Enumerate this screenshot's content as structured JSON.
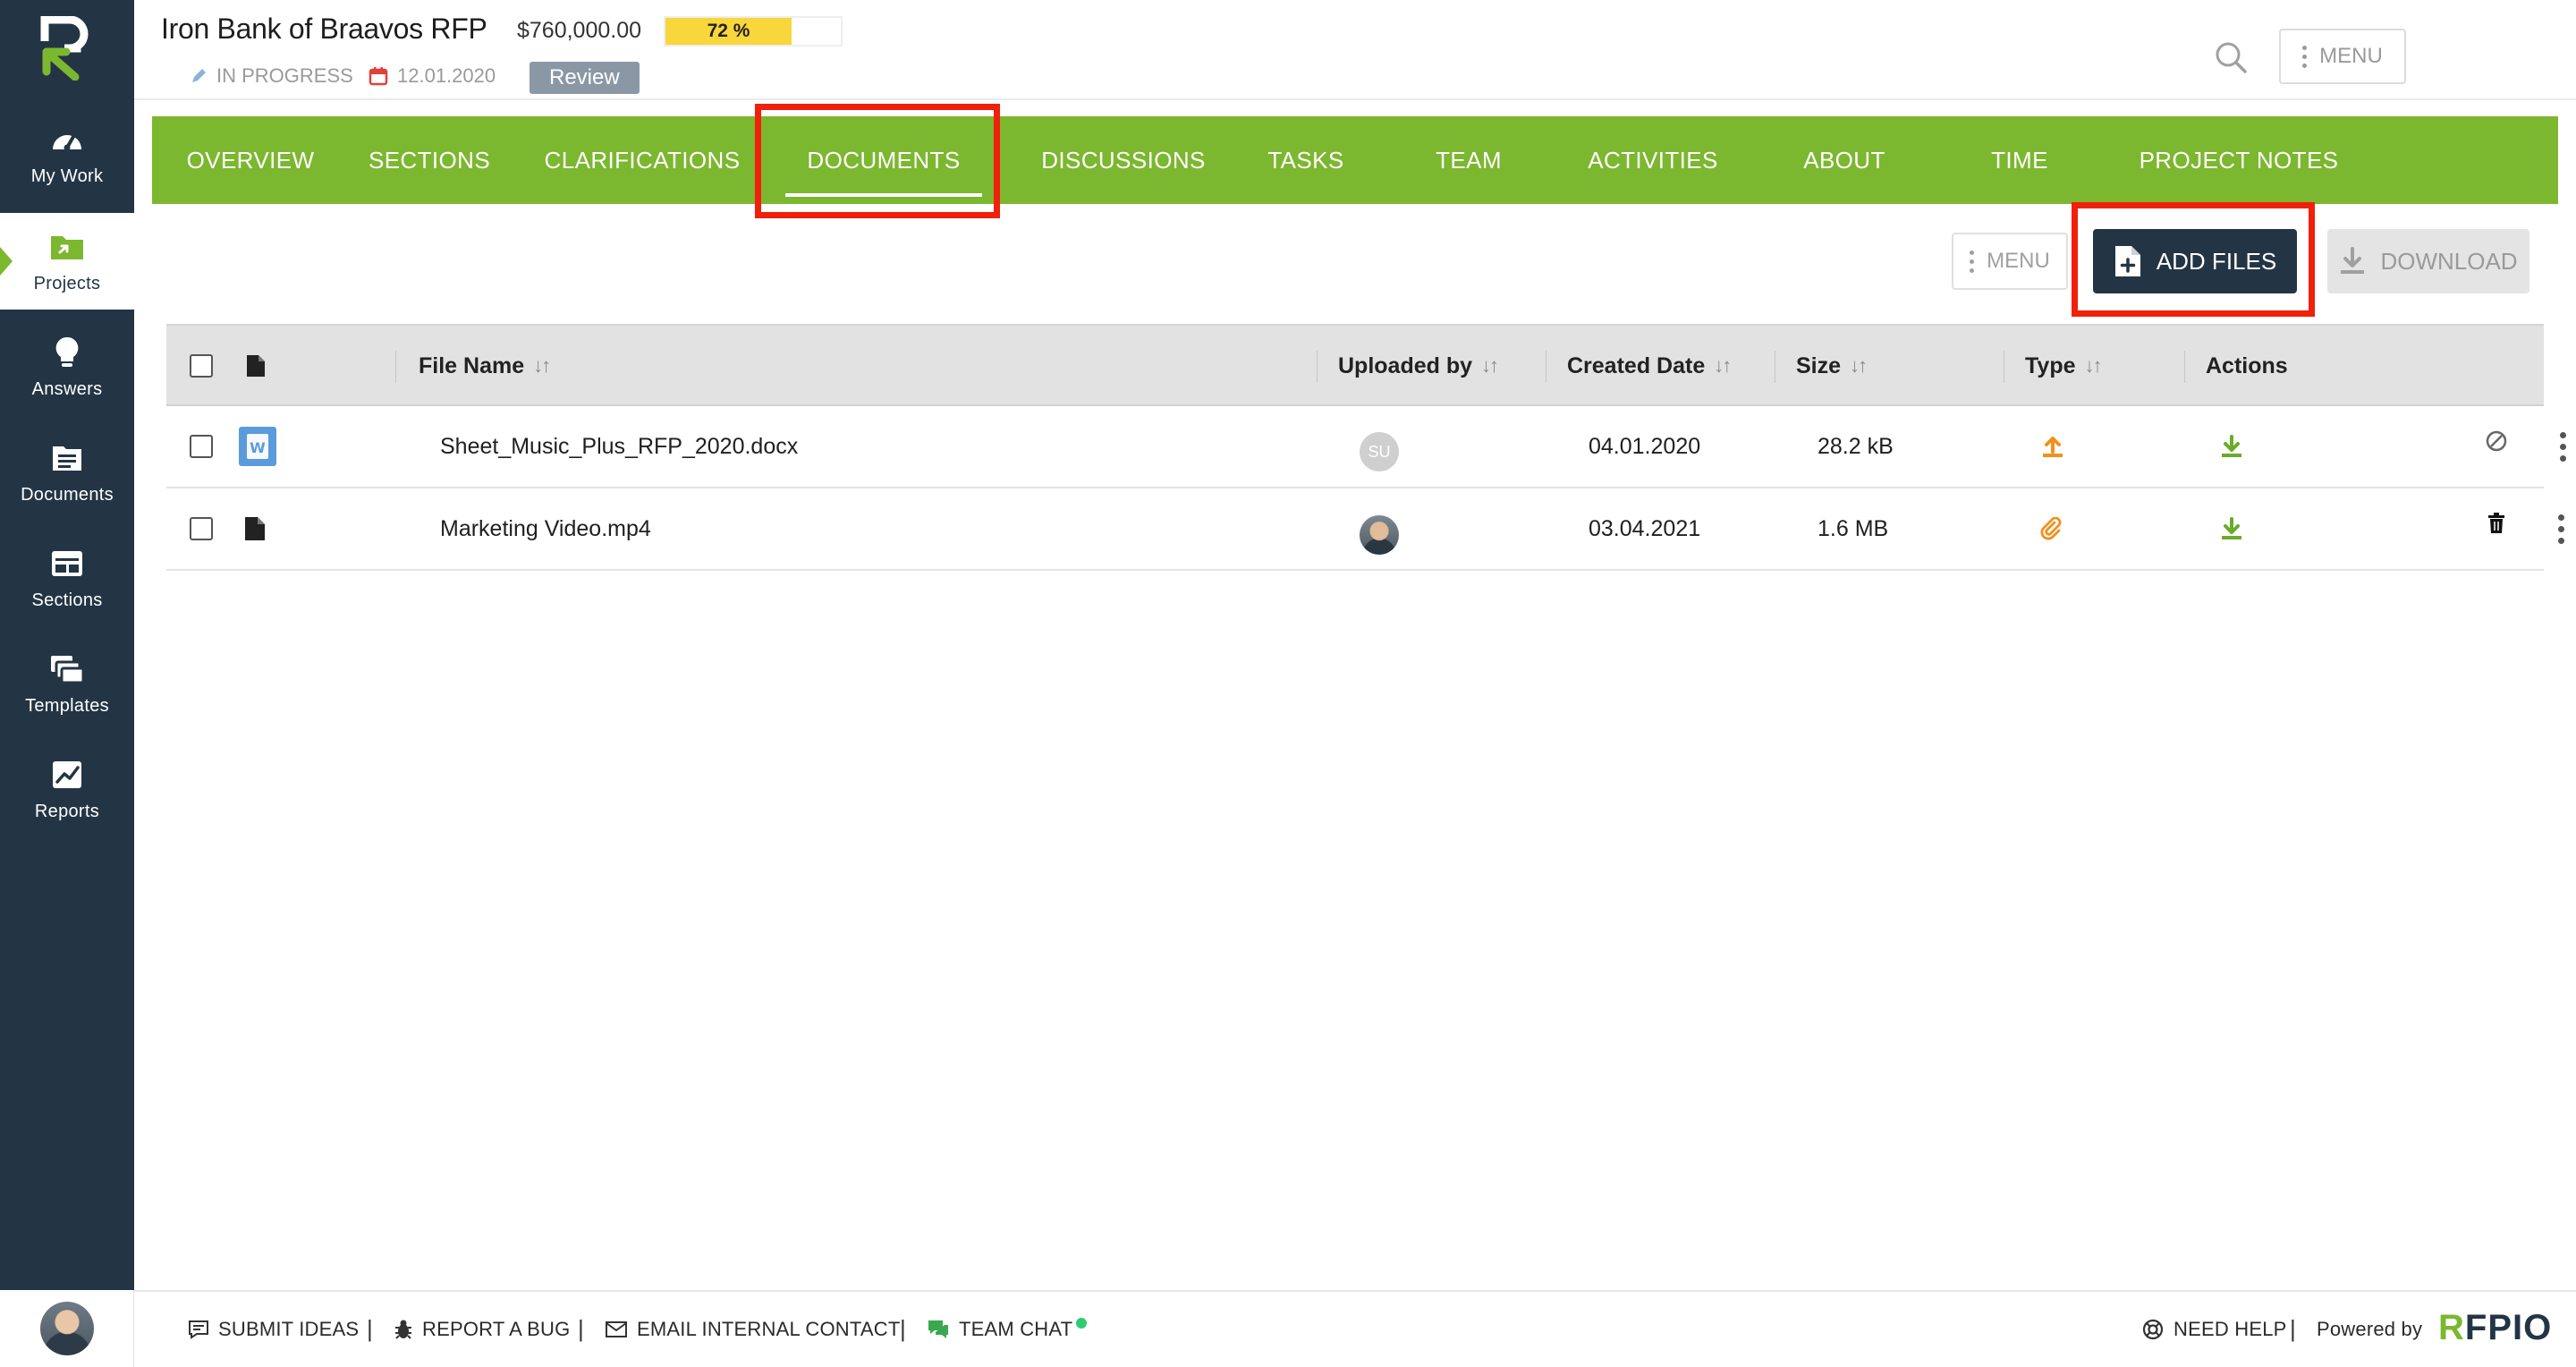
{
  "sidebar": {
    "items": [
      {
        "label": "My Work",
        "icon": "dashboard-icon"
      },
      {
        "label": "Projects",
        "icon": "projects-icon",
        "active": true
      },
      {
        "label": "Answers",
        "icon": "lightbulb-icon"
      },
      {
        "label": "Documents",
        "icon": "documents-icon"
      },
      {
        "label": "Sections",
        "icon": "sections-icon"
      },
      {
        "label": "Templates",
        "icon": "templates-icon"
      },
      {
        "label": "Reports",
        "icon": "reports-icon"
      }
    ]
  },
  "header": {
    "title": "Iron Bank of Braavos RFP",
    "value": "$760,000.00",
    "progress": {
      "percent": 72,
      "label": "72 %"
    },
    "status": "IN PROGRESS",
    "due_date": "12.01.2020",
    "stage": "Review",
    "menu_label": "MENU"
  },
  "tabs": [
    {
      "label": "OVERVIEW"
    },
    {
      "label": "SECTIONS"
    },
    {
      "label": "CLARIFICATIONS"
    },
    {
      "label": "DOCUMENTS",
      "active": true
    },
    {
      "label": "DISCUSSIONS"
    },
    {
      "label": "TASKS"
    },
    {
      "label": "TEAM"
    },
    {
      "label": "ACTIVITIES"
    },
    {
      "label": "ABOUT"
    },
    {
      "label": "TIME"
    },
    {
      "label": "PROJECT NOTES"
    }
  ],
  "toolbar": {
    "menu_label": "MENU",
    "add_files_label": "ADD FILES",
    "download_label": "DOWNLOAD"
  },
  "table": {
    "columns": {
      "file_name": "File Name",
      "uploaded_by": "Uploaded by",
      "created_date": "Created Date",
      "size": "Size",
      "type": "Type",
      "actions": "Actions",
      "sort_glyph": "↓↑"
    },
    "rows": [
      {
        "file_name": "Sheet_Music_Plus_RFP_2020.docx",
        "uploader_initials": "SU",
        "created_date": "04.01.2020",
        "size": "28.2 kB",
        "type_icon": "upload-icon",
        "file_icon": "word-doc-icon"
      },
      {
        "file_name": "Marketing Video.mp4",
        "uploader_initials": "",
        "created_date": "03.04.2021",
        "size": "1.6 MB",
        "type_icon": "paperclip-icon",
        "file_icon": "file-icon"
      }
    ]
  },
  "footer": {
    "submit_ideas": "SUBMIT IDEAS",
    "report_bug": "REPORT A BUG",
    "email_contact": "EMAIL INTERNAL CONTACT",
    "team_chat": "TEAM CHAT",
    "need_help": "NEED HELP",
    "powered_by": "Powered by",
    "brand_r": "R",
    "brand_rest": "FPIO",
    "separator": "|"
  },
  "colors": {
    "sidebar": "#233545",
    "accent_green": "#7cb730",
    "highlight_red": "#f0200a",
    "progress_yellow": "#f9d63b"
  }
}
